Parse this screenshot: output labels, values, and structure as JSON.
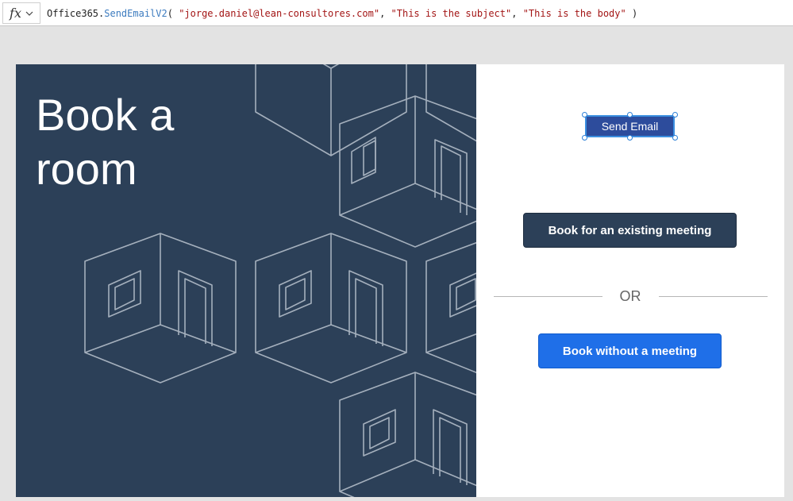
{
  "formula_bar": {
    "fx_label": "fx",
    "expression": {
      "object": "Office365.",
      "function": "SendEmailV2",
      "open": "( ",
      "arg1": "\"jorge.daniel@lean-consultores.com\"",
      "arg2": "\"This is the subject\"",
      "arg3": "\"This is the body\"",
      "sep": ", ",
      "close": " )"
    }
  },
  "screen": {
    "title_line1": "Book a",
    "title_line2": "room",
    "send_email_label": "Send Email",
    "book_existing_label": "Book for an existing meeting",
    "or_label": "OR",
    "book_without_label": "Book without a meeting"
  },
  "icons": {
    "fx": "fx-icon",
    "chevron": "chevron-down-icon",
    "pattern": "room-pattern-illustration"
  },
  "colors": {
    "panel_navy": "#2c4058",
    "primary_blue": "#1f6fe8",
    "send_email_bg": "#2d4c9c",
    "selection_handle": "#2b7fd6"
  }
}
